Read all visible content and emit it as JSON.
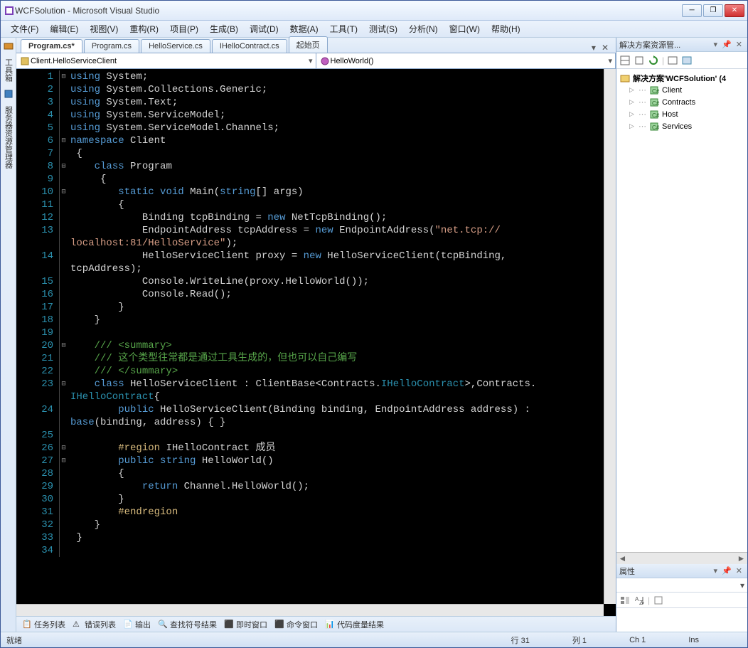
{
  "window": {
    "title": "WCFSolution - Microsoft Visual Studio"
  },
  "menu": [
    "文件(F)",
    "编辑(E)",
    "视图(V)",
    "重构(R)",
    "项目(P)",
    "生成(B)",
    "调试(D)",
    "数据(A)",
    "工具(T)",
    "测试(S)",
    "分析(N)",
    "窗口(W)",
    "帮助(H)"
  ],
  "leftTabs": [
    "工具箱",
    "服务器资源管理器"
  ],
  "docTabs": [
    {
      "label": "Program.cs*",
      "active": true
    },
    {
      "label": "Program.cs",
      "active": false
    },
    {
      "label": "HelloService.cs",
      "active": false
    },
    {
      "label": "IHelloContract.cs",
      "active": false
    },
    {
      "label": "起始页",
      "active": false
    }
  ],
  "nav": {
    "left": "Client.HelloServiceClient",
    "right": "HelloWorld()"
  },
  "code": {
    "lines": [
      {
        "n": 1,
        "fold": "⊟",
        "html": "<span class='kw'>using</span> <span class='wht'>System;</span>"
      },
      {
        "n": 2,
        "fold": "",
        "html": "<span class='kw'>using</span> <span class='wht'>System.Collections.Generic;</span>"
      },
      {
        "n": 3,
        "fold": "",
        "html": "<span class='kw'>using</span> <span class='wht'>System.Text;</span>"
      },
      {
        "n": 4,
        "fold": "",
        "html": "<span class='kw'>using</span> <span class='wht'>System.ServiceModel;</span>"
      },
      {
        "n": 5,
        "fold": "",
        "html": "<span class='kw'>using</span> <span class='wht'>System.ServiceModel.Channels;</span>"
      },
      {
        "n": 6,
        "fold": "⊟",
        "html": "<span class='kw'>namespace</span> <span class='wht'>Client</span>"
      },
      {
        "n": 7,
        "fold": "",
        "html": " <span class='wht'>{</span>"
      },
      {
        "n": 8,
        "fold": "⊟",
        "html": "    <span class='kw'>class</span> <span class='wht'>Program</span>"
      },
      {
        "n": 9,
        "fold": "",
        "html": "     <span class='wht'>{</span>"
      },
      {
        "n": 10,
        "fold": "⊟",
        "html": "        <span class='kw'>static</span> <span class='kw'>void</span> <span class='wht'>Main(</span><span class='kw'>string</span><span class='wht'>[] args)</span>"
      },
      {
        "n": 11,
        "fold": "",
        "html": "        <span class='wht'>{</span>"
      },
      {
        "n": 12,
        "fold": "",
        "html": "            <span class='wht'>Binding tcpBinding = </span><span class='kw'>new</span> <span class='wht'>NetTcpBinding();</span>"
      },
      {
        "n": 13,
        "fold": "",
        "cont": true,
        "html": "            <span class='wht'>EndpointAddress tcpAddress = </span><span class='kw'>new</span> <span class='wht'>EndpointAddress(</span><span class='str'>\"net.tcp://</span>"
      },
      {
        "n": 0,
        "fold": "",
        "html": "<span class='str'>localhost:81/HelloService\"</span><span class='wht'>);</span>"
      },
      {
        "n": 14,
        "fold": "",
        "cont": true,
        "html": "            <span class='wht'>HelloServiceClient proxy = </span><span class='kw'>new</span> <span class='wht'>HelloServiceClient(tcpBinding, </span>"
      },
      {
        "n": 0,
        "fold": "",
        "html": "<span class='wht'>tcpAddress);</span>"
      },
      {
        "n": 15,
        "fold": "",
        "html": "            <span class='wht'>Console.WriteLine(proxy.HelloWorld());</span>"
      },
      {
        "n": 16,
        "fold": "",
        "html": "            <span class='wht'>Console.Read();</span>"
      },
      {
        "n": 17,
        "fold": "",
        "html": "        <span class='wht'>}</span>"
      },
      {
        "n": 18,
        "fold": "",
        "html": "    <span class='wht'>}</span>"
      },
      {
        "n": 19,
        "fold": "",
        "html": ""
      },
      {
        "n": 20,
        "fold": "⊟",
        "html": "    <span class='cmt'>/// &lt;summary&gt;</span>"
      },
      {
        "n": 21,
        "fold": "",
        "html": "    <span class='cmt'>/// 这个类型往常都是通过工具生成的，但也可以自己编写</span>"
      },
      {
        "n": 22,
        "fold": "",
        "html": "    <span class='cmt'>/// &lt;/summary&gt;</span>"
      },
      {
        "n": 23,
        "fold": "⊟",
        "cont": true,
        "html": "    <span class='kw'>class</span> <span class='wht'>HelloServiceClient : ClientBase&lt;Contracts.</span><span class='type'>IHelloContract</span><span class='wht'>&gt;,Contracts.</span>"
      },
      {
        "n": 0,
        "fold": "",
        "html": "<span class='type'>IHelloContract</span><span class='wht'>{</span>"
      },
      {
        "n": 24,
        "fold": "",
        "cont": true,
        "html": "        <span class='kw'>public</span> <span class='wht'>HelloServiceClient(Binding binding, EndpointAddress address) : </span>"
      },
      {
        "n": 0,
        "fold": "",
        "html": "<span class='kw'>base</span><span class='wht'>(binding, address) { }</span>"
      },
      {
        "n": 25,
        "fold": "",
        "html": ""
      },
      {
        "n": 26,
        "fold": "⊟",
        "html": "        <span class='region'>#region</span> <span class='wht'>IHelloContract 成员</span>"
      },
      {
        "n": 27,
        "fold": "⊟",
        "html": "        <span class='kw'>public</span> <span class='kw'>string</span> <span class='wht'>HelloWorld()</span>"
      },
      {
        "n": 28,
        "fold": "",
        "html": "        <span class='wht'>{</span>"
      },
      {
        "n": 29,
        "fold": "",
        "html": "            <span class='kw'>return</span> <span class='wht'>Channel.HelloWorld();</span>"
      },
      {
        "n": 30,
        "fold": "",
        "html": "        <span class='wht'>}</span>"
      },
      {
        "n": 31,
        "fold": "",
        "html": "        <span class='region'>#endregion</span>"
      },
      {
        "n": 32,
        "fold": "",
        "html": "    <span class='wht'>}</span>"
      },
      {
        "n": 33,
        "fold": "",
        "html": " <span class='wht'>}</span>"
      },
      {
        "n": 34,
        "fold": "",
        "html": ""
      }
    ]
  },
  "bottomTabs": [
    "任务列表",
    "错误列表",
    "输出",
    "查找符号结果",
    "即时窗口",
    "命令窗口",
    "代码度量结果"
  ],
  "solExp": {
    "title": "解决方案资源管...",
    "root": "解决方案'WCFSolution' (4",
    "items": [
      "Client",
      "Contracts",
      "Host",
      "Services"
    ]
  },
  "propPanel": {
    "title": "属性"
  },
  "status": {
    "ready": "就绪",
    "line": "行 31",
    "col": "列 1",
    "ch": "Ch 1",
    "ins": "Ins"
  }
}
